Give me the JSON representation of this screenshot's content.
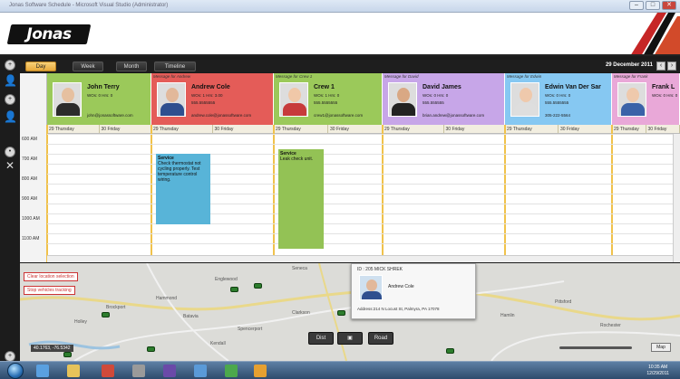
{
  "window": {
    "title": "Jonas Software Schedule - Microsoft Visual Studio (Administrator)"
  },
  "brand": {
    "logo_text": "Jonas"
  },
  "views": {
    "tabs": [
      "Day",
      "Week",
      "Month",
      "Timeline"
    ],
    "active": "Day"
  },
  "date_label": "29 December 2011",
  "times": [
    "600 AM",
    "700 AM",
    "800 AM",
    "900 AM",
    "1000 AM",
    "1100 AM"
  ],
  "technicians": [
    {
      "message": "",
      "name": "John Terry",
      "line1": "WOs: 0  Hrs: 0",
      "line2": "",
      "email": "john@jonassoftware.com",
      "color": "#9bc95a",
      "photo_skin": "#e6c0a0",
      "photo_shirt": "#2b2b2b"
    },
    {
      "message": "Message for Andrew",
      "name": "Andrew Cole",
      "line1": "WOs: 1  Hrs: 3.00",
      "line2": "555.5555555",
      "email": "andrew.cole@jonassoftware.com",
      "color": "#e45c58",
      "photo_skin": "#e2b89a",
      "photo_shirt": "#2f4f8f"
    },
    {
      "message": "Message for Crew 1",
      "name": "Crew 1",
      "line1": "WOs: 1  Hrs: 0",
      "line2": "555.5555555",
      "email": "crew1@jonassoftware.com",
      "color": "#9bc95a",
      "photo_skin": "#f0c8a8",
      "photo_shirt": "#c73b3b"
    },
    {
      "message": "Message for David",
      "name": "David James",
      "line1": "WOs: 0  Hrs: 0",
      "line2": "555.555555",
      "email": "brian.andrew@jonassoftware.com",
      "color": "#c7a6e8",
      "photo_skin": "#d9a884",
      "photo_shirt": "#222222"
    },
    {
      "message": "Message for Edwin",
      "name": "Edwin Van Der Sar",
      "line1": "WOs: 0  Hrs: 0",
      "line2": "555.5555555",
      "email": "305-222-5564",
      "color": "#86c8f2",
      "photo_skin": "#efc9ac",
      "photo_shirt": "#dedede"
    },
    {
      "message": "Message for Frank",
      "name": "Frank L",
      "line1": "WOs: 0  Hrs: 0",
      "line2": "",
      "email": "",
      "color": "#e9a8d8",
      "photo_skin": "#efc9ac",
      "photo_shirt": "#3a62a8"
    }
  ],
  "days": [
    "29 Thursday",
    "30 Friday"
  ],
  "appointments": [
    {
      "title": "Service",
      "text": "Check thermostat not cycling properly. Test temperature control wiring.",
      "color": "#58b4d8"
    },
    {
      "title": "Service",
      "text": "Leak check unit.",
      "color": "#93c255"
    }
  ],
  "map": {
    "buttons": {
      "clear": "Clear location selection",
      "stop": "Stop vehicles tracking"
    },
    "towns": [
      "Englewood",
      "Seneca",
      "Hammond",
      "Brockport",
      "Holley",
      "Batavia",
      "Spencerport",
      "Clarkson",
      "Kendall",
      "Hamlin",
      "Pittsford",
      "Rochester"
    ],
    "popup": {
      "id": "ID : 205 MICK SHREK",
      "name": "Andrew Cole",
      "address": "Address:214 N Locust St, Palmyra, PA 17078"
    },
    "controls": {
      "left": "Dist",
      "right": "Road"
    },
    "coords": "40.1763, -76.5342"
  },
  "taskbar": {
    "time": "10:35 AM",
    "date": "12/29/2011"
  }
}
